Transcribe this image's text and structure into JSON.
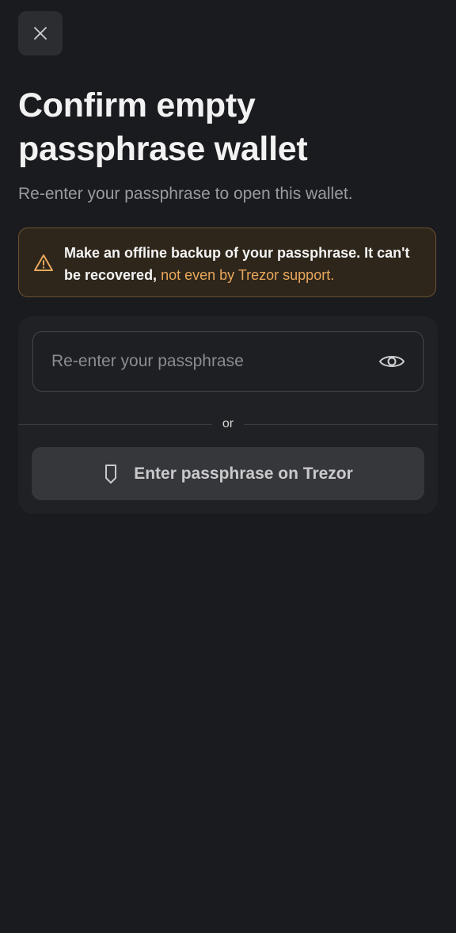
{
  "header": {
    "close_icon": "close-icon"
  },
  "page": {
    "title": "Confirm empty passphrase wallet",
    "subtitle": "Re-enter your passphrase to open this wallet."
  },
  "warning": {
    "icon": "warning-triangle-icon",
    "strong_text": "Make an offline backup of your passphrase. It can't be recovered,",
    "link_text": "not even by Trezor support.",
    "accent_color": "#e8a85c"
  },
  "form": {
    "passphrase_placeholder": "Re-enter your passphrase",
    "passphrase_value": "",
    "reveal_icon": "eye-icon",
    "divider_text": "or",
    "device_button_label": "Enter passphrase on Trezor",
    "device_button_icon": "trezor-device-icon"
  }
}
